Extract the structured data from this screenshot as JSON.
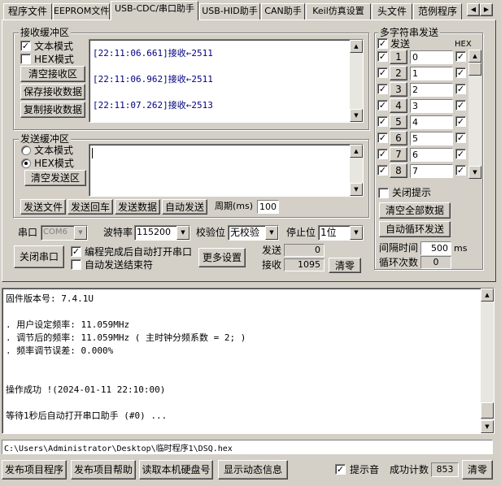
{
  "tabs": [
    {
      "label": "程序文件",
      "active": false
    },
    {
      "label": "EEPROM文件",
      "active": false
    },
    {
      "label": "USB-CDC/串口助手",
      "active": true
    },
    {
      "label": "USB-HID助手",
      "active": false
    },
    {
      "label": "CAN助手",
      "active": false
    },
    {
      "label": "Keil仿真设置",
      "active": false
    },
    {
      "label": "头文件",
      "active": false
    },
    {
      "label": "范例程序",
      "active": false
    }
  ],
  "receive": {
    "title": "接收缓冲区",
    "text_mode": "文本模式",
    "hex_mode": "HEX模式",
    "clear_btn": "清空接收区",
    "save_btn": "保存接收数据",
    "copy_btn": "复制接收数据",
    "lines": [
      "[22:11:06.661]接收←2511",
      "[22:11:06.962]接收←2511",
      "[22:11:07.262]接收←2513"
    ]
  },
  "send": {
    "title": "发送缓冲区",
    "text_mode": "文本模式",
    "hex_mode": "HEX模式",
    "clear_btn": "清空发送区",
    "send_file": "发送文件",
    "send_return": "发送回车",
    "send_data": "发送数据",
    "auto_send": "自动发送",
    "period_label": "周期(ms)",
    "period_value": "100"
  },
  "serial": {
    "port_label": "串口",
    "port_value": "COM6",
    "baud_label": "波特率",
    "baud_value": "115200",
    "parity_label": "校验位",
    "parity_value": "无校验",
    "stop_label": "停止位",
    "stop_value": "1位",
    "close_port": "关闭串口",
    "auto_open": "编程完成后自动打开串口",
    "auto_end": "自动发送结束符",
    "more_settings": "更多设置",
    "send_count_label": "发送",
    "send_count": "0",
    "recv_count_label": "接收",
    "recv_count": "1095",
    "clear_btn": "清零"
  },
  "multi": {
    "title": "多字符串发送",
    "send_header": "发送",
    "hex_header": "HEX",
    "rows": [
      {
        "num": "1",
        "value": "0"
      },
      {
        "num": "2",
        "value": "1"
      },
      {
        "num": "3",
        "value": "2"
      },
      {
        "num": "4",
        "value": "3"
      },
      {
        "num": "5",
        "value": "4"
      },
      {
        "num": "6",
        "value": "5"
      },
      {
        "num": "7",
        "value": "6"
      },
      {
        "num": "8",
        "value": "7"
      }
    ],
    "close_tip": "关闭提示",
    "clear_all": "清空全部数据",
    "auto_loop": "自动循环发送",
    "interval_label": "间隔时间",
    "interval_value": "500",
    "interval_unit": "ms",
    "loop_label": "循环次数",
    "loop_value": "0"
  },
  "log": {
    "lines": [
      "  固件版本号: 7.4.1U",
      "",
      "  . 用户设定频率: 11.059MHz",
      "  . 调节后的频率: 11.059MHz ( 主时钟分频系数 = 2; )",
      "  . 频率调节误差: 0.000%",
      "",
      "",
      "操作成功 !(2024-01-11 22:10:00)",
      "",
      "等待1秒后自动打开串口助手 (#0) ..."
    ]
  },
  "path": "C:\\Users\\Administrator\\Desktop\\临时程序1\\DSQ.hex",
  "bottom": {
    "publish_program": "发布项目程序",
    "publish_help": "发布项目帮助",
    "read_disk": "读取本机硬盘号",
    "show_dynamic": "显示动态信息",
    "beep": "提示音",
    "success_label": "成功计数",
    "success_count": "853",
    "clear_btn": "清零"
  }
}
